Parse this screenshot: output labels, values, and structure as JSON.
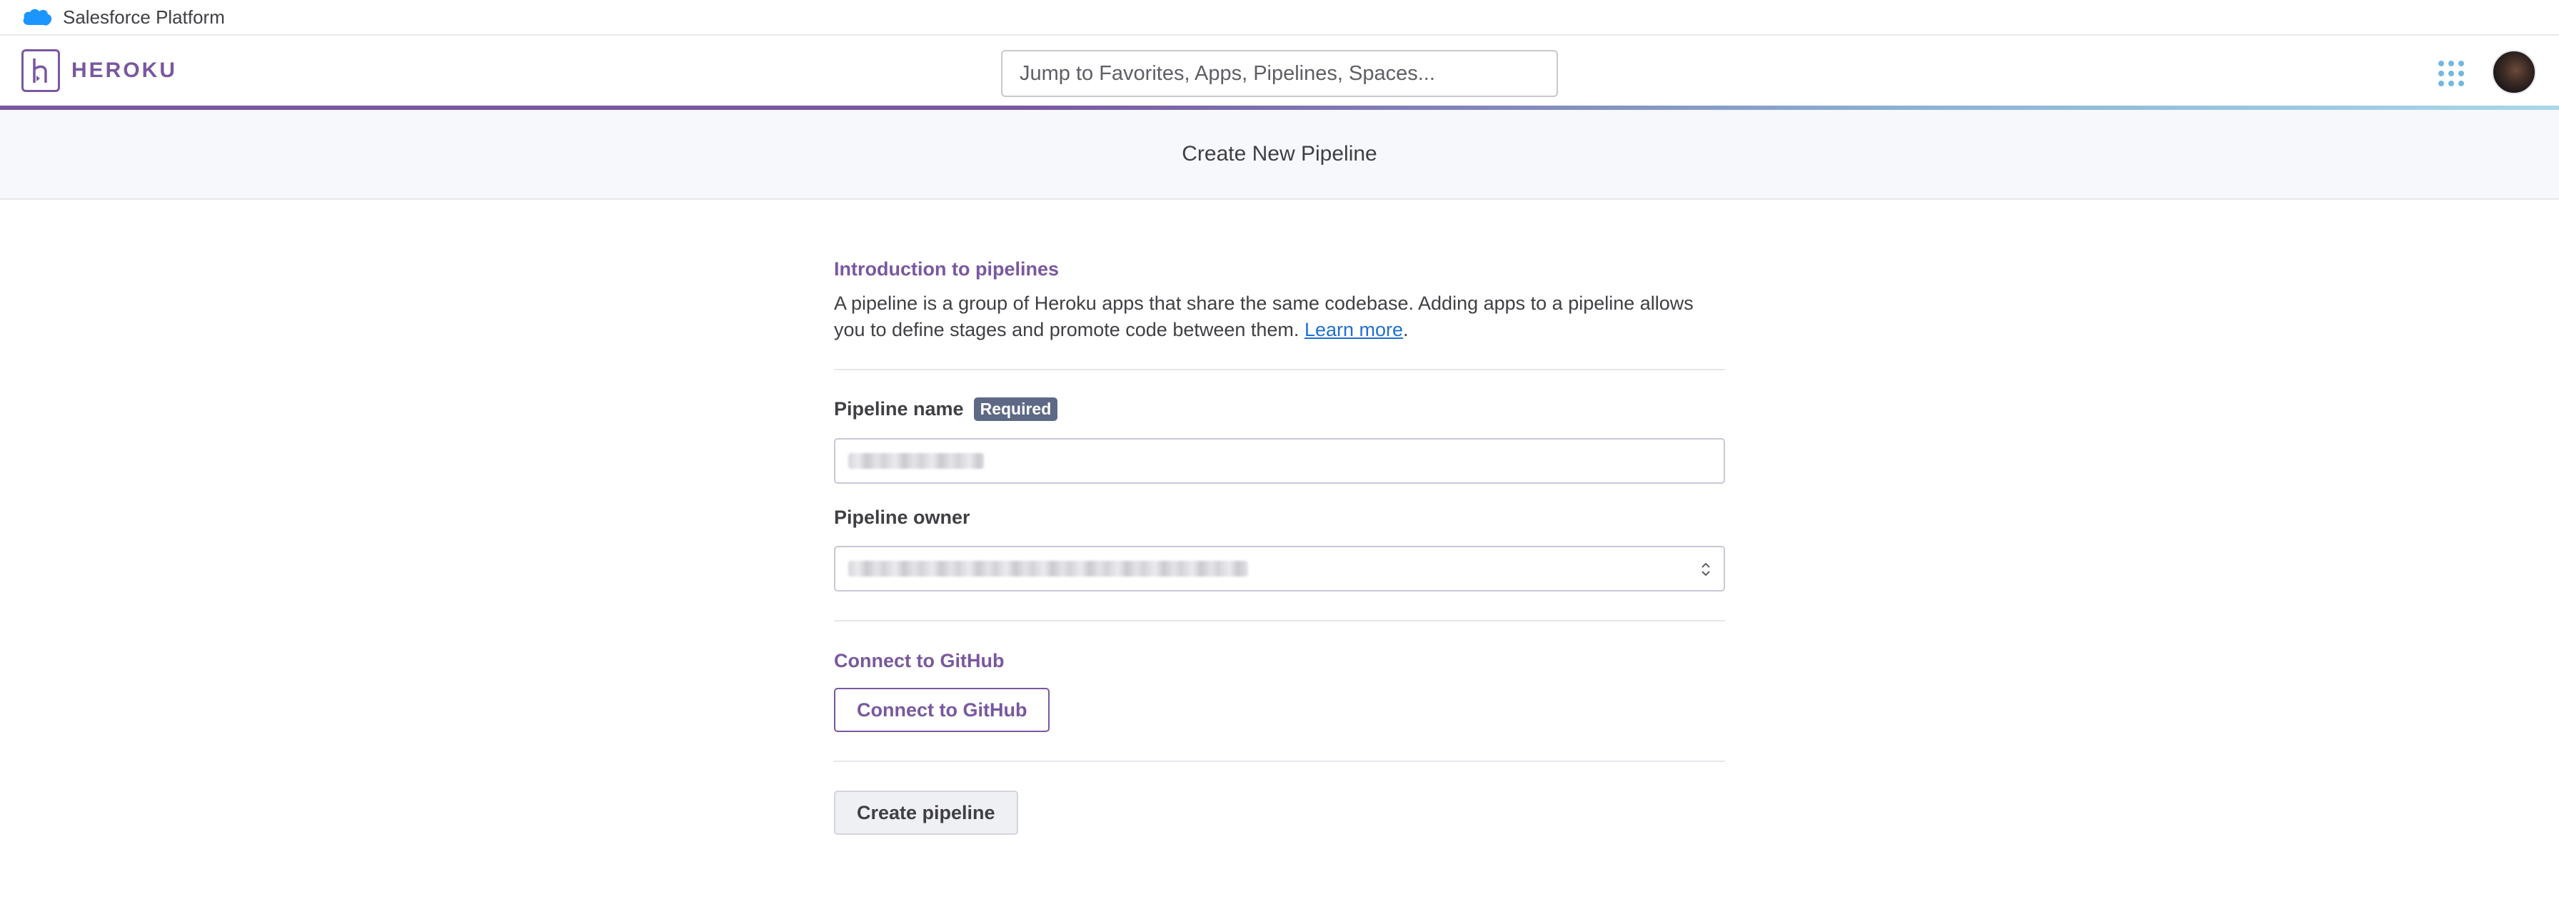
{
  "topbar": {
    "label": "Salesforce Platform",
    "logo_icon": "salesforce-cloud-icon",
    "logo_color": "#1b96ff"
  },
  "header": {
    "brand": "HEROKU",
    "brand_color": "#79589f",
    "search_placeholder": "Jump to Favorites, Apps, Pipelines, Spaces...",
    "apps_icon": "apps-grid-icon",
    "avatar_icon": "user-avatar"
  },
  "page": {
    "title": "Create New Pipeline"
  },
  "intro": {
    "title": "Introduction to pipelines",
    "body": "A pipeline is a group of Heroku apps that share the same codebase. Adding apps to a pipeline allows you to define stages and promote code between them.",
    "link": "Learn more",
    "suffix": "."
  },
  "form": {
    "name_label": "Pipeline name",
    "required_badge": "Required",
    "owner_label": "Pipeline owner"
  },
  "github": {
    "title": "Connect to GitHub",
    "button": "Connect to GitHub"
  },
  "actions": {
    "create_button": "Create pipeline"
  }
}
